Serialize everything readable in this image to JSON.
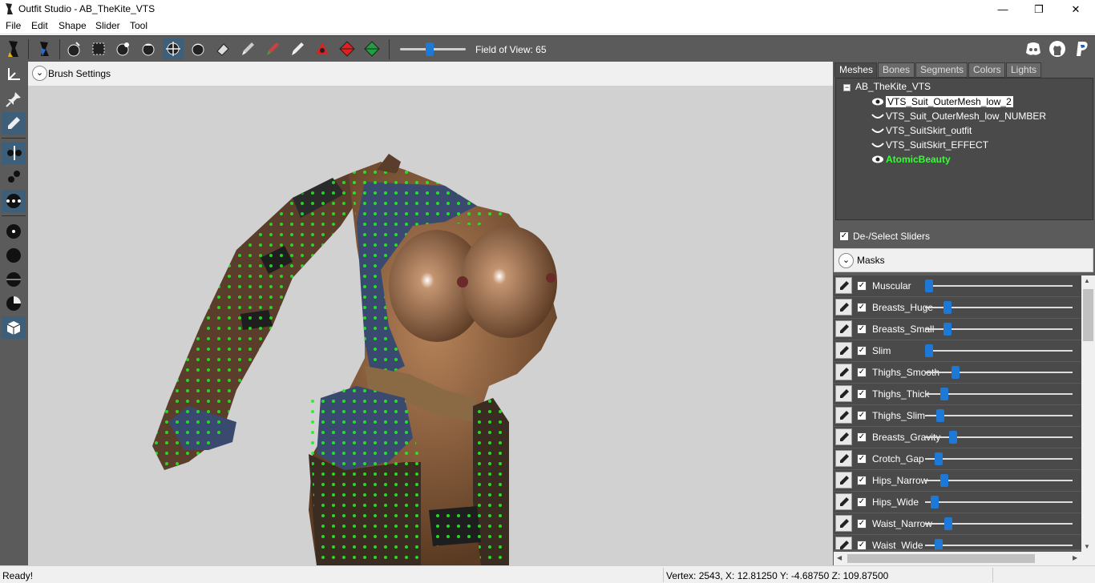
{
  "window": {
    "title": "Outfit Studio - AB_TheKite_VTS",
    "minimize_glyph": "—",
    "maximize_glyph": "❐",
    "close_glyph": "✕"
  },
  "menu": [
    "File",
    "Edit",
    "Shape",
    "Slider",
    "Tool"
  ],
  "toolbar": {
    "fov_label": "Field of View: 65",
    "fov_value": 65,
    "icons": [
      "logo-icon",
      "mesh-icon",
      "select-icon",
      "mask-icon",
      "inflate-icon",
      "deflate-icon",
      "move-icon",
      "smooth-icon",
      "erase-icon",
      "brush-icon",
      "color-icon",
      "alpha-icon",
      "transform-icon",
      "pivot-icon",
      "vertex-icon"
    ],
    "right_icons": [
      "discord-icon",
      "github-icon",
      "paypal-icon"
    ]
  },
  "left_tools": [
    "axis-icon",
    "pin-icon",
    "pencil-icon",
    "split-icon",
    "weld-icon",
    "dots-icon",
    "small-dot-icon",
    "large-dot-icon",
    "half-dot-icon",
    "partial-dot-icon",
    "cube-icon"
  ],
  "viewport": {
    "brush_settings_label": "Brush Settings",
    "toggle_glyph": "⌄"
  },
  "right_panel": {
    "tabs": [
      "Meshes",
      "Bones",
      "Segments",
      "Colors",
      "Lights"
    ],
    "active_tab": "Meshes",
    "tree": {
      "root": "AB_TheKite_VTS",
      "root_box": "−",
      "items": [
        {
          "label": "VTS_Suit_OuterMesh_low_2",
          "icon": "eye-icon",
          "state": "selected"
        },
        {
          "label": "VTS_Suit_OuterMesh_low_NUMBER",
          "icon": "eye-closed-icon",
          "state": "normal"
        },
        {
          "label": "VTS_SuitSkirt_outfit",
          "icon": "eye-closed-icon",
          "state": "normal"
        },
        {
          "label": "VTS_SuitSkirt_EFFECT",
          "icon": "eye-closed-icon",
          "state": "normal"
        },
        {
          "label": "AtomicBeauty",
          "icon": "eye-icon",
          "state": "reference"
        }
      ]
    },
    "deselect_label": "De-/Select Sliders",
    "masks_label": "Masks",
    "checkmark": "✓",
    "sliders": [
      {
        "name": "Muscular",
        "value": 0.0,
        "checked": true
      },
      {
        "name": "Breasts_Huge",
        "value": 0.13,
        "checked": true
      },
      {
        "name": "Breasts_Small",
        "value": 0.13,
        "checked": true
      },
      {
        "name": "Slim",
        "value": 0.0,
        "checked": true
      },
      {
        "name": "Thighs_Smooth",
        "value": 0.19,
        "checked": true
      },
      {
        "name": "Thighs_Thick",
        "value": 0.11,
        "checked": true
      },
      {
        "name": "Thighs_Slim",
        "value": 0.08,
        "checked": true
      },
      {
        "name": "Breasts_Gravity",
        "value": 0.17,
        "checked": true
      },
      {
        "name": "Crotch_Gap",
        "value": 0.07,
        "checked": true
      },
      {
        "name": "Hips_Narrow",
        "value": 0.11,
        "checked": true
      },
      {
        "name": "Hips_Wide",
        "value": 0.04,
        "checked": true
      },
      {
        "name": "Waist_Narrow",
        "value": 0.14,
        "checked": true
      },
      {
        "name": "Waist_Wide",
        "value": 0.07,
        "checked": true
      }
    ]
  },
  "status": {
    "left": "Ready!",
    "right": "Vertex: 2543, X: 12.81250 Y: -4.68750 Z: 109.87500"
  },
  "colors": {
    "panel": "#5b5b5b",
    "accent": "#1e78d6",
    "vertex_green": "#22ee22",
    "reference_mesh": "#33ff33"
  }
}
